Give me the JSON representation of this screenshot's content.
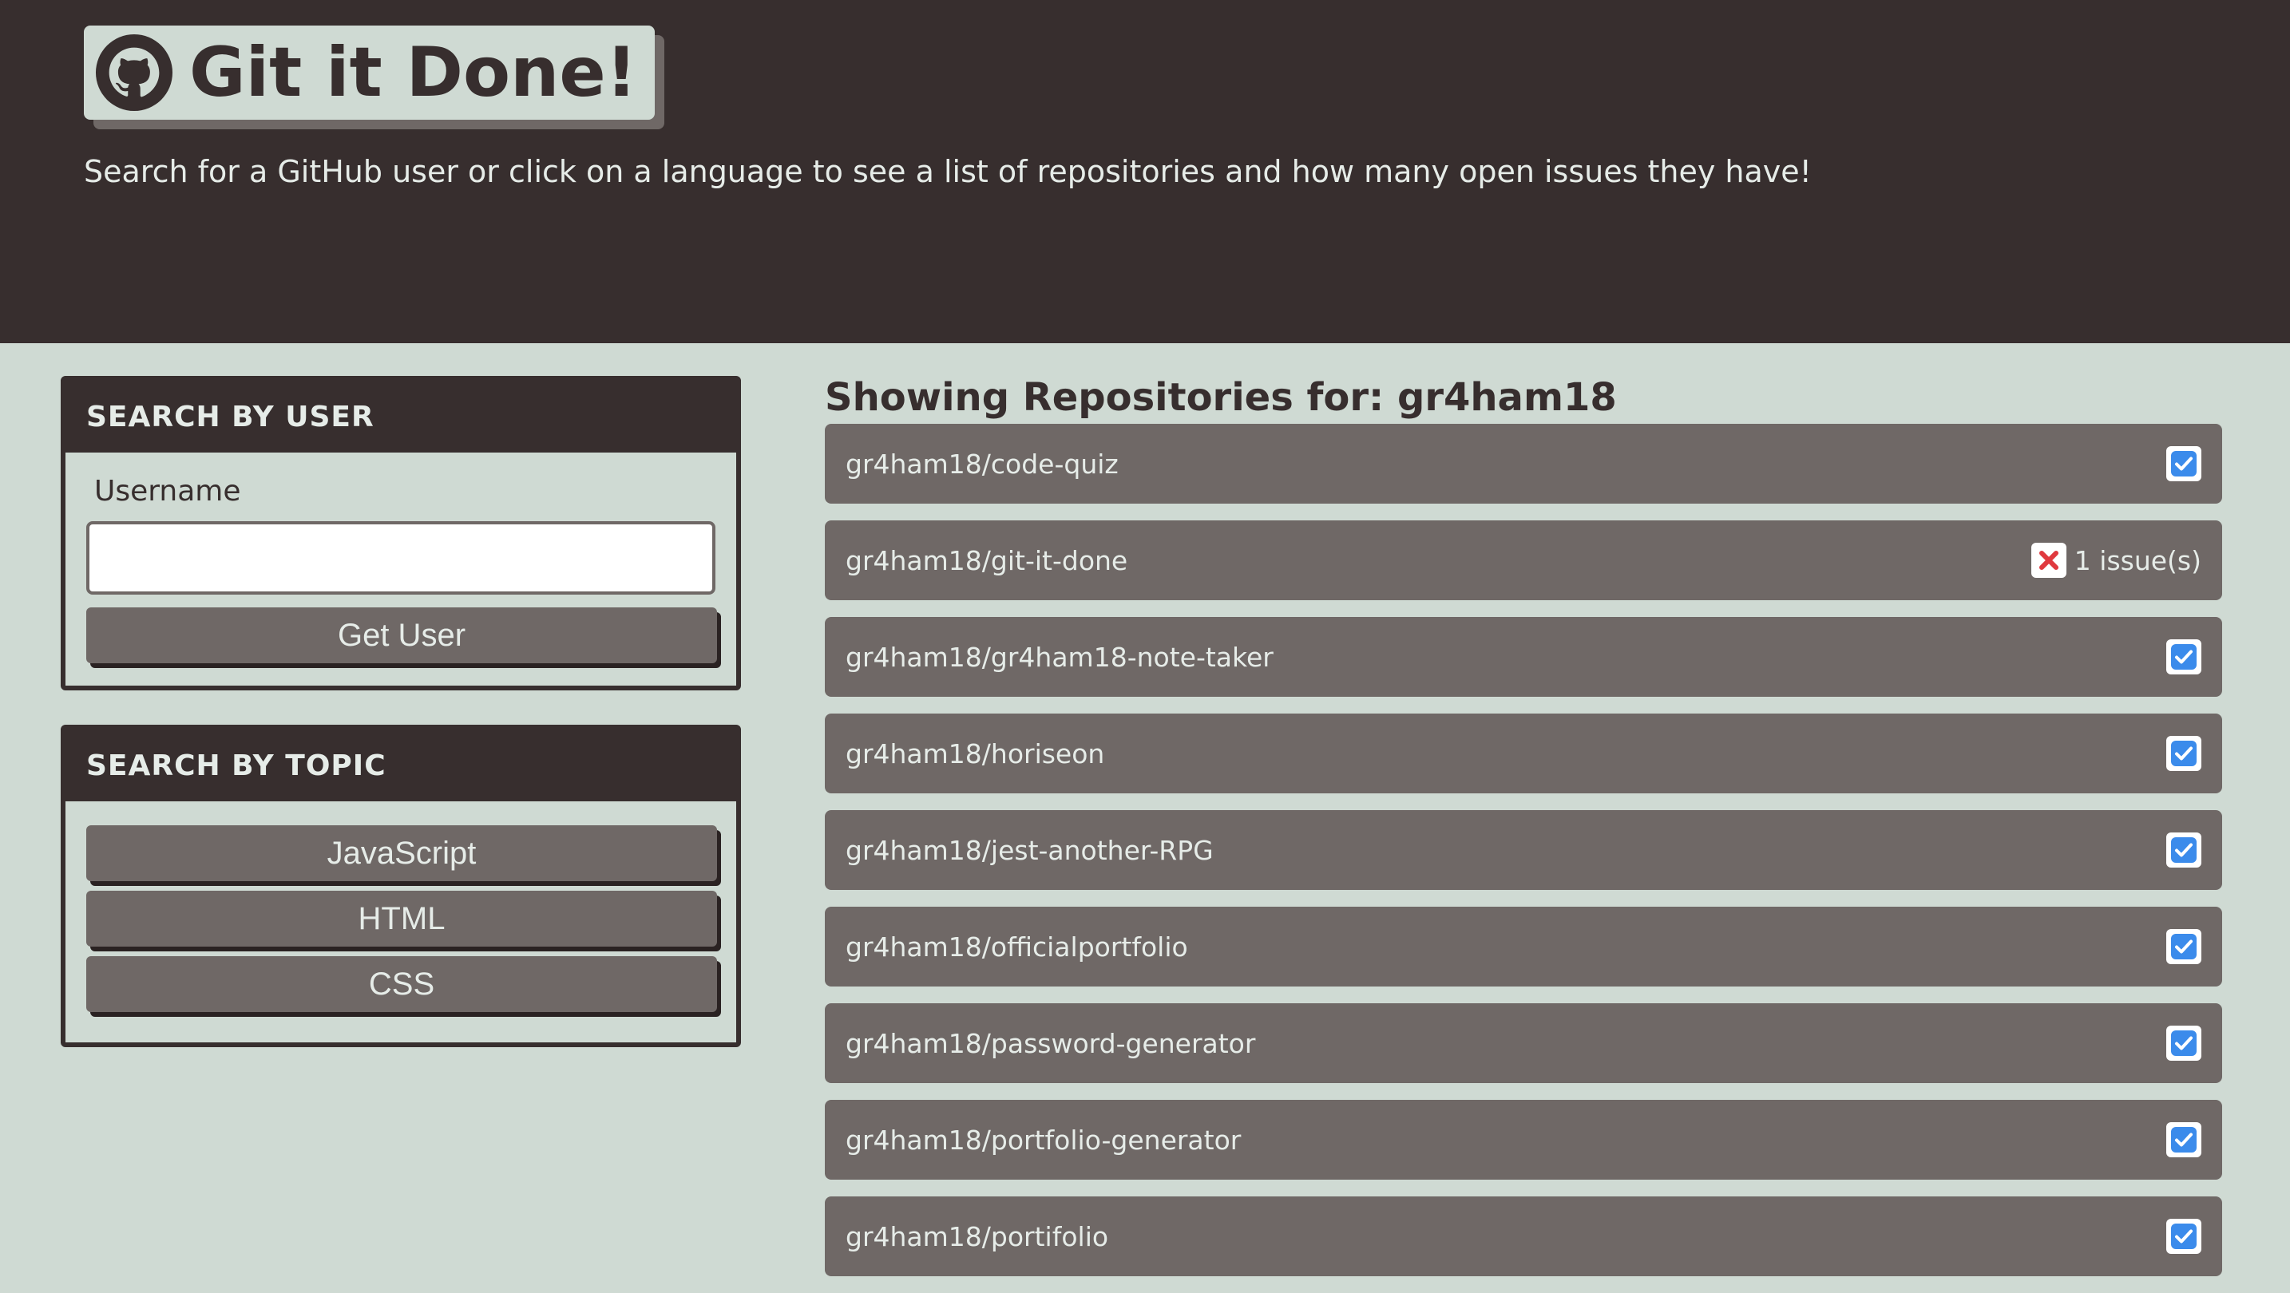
{
  "header": {
    "title": "Git it Done!",
    "subtitle": "Search for a GitHub user or click on a language to see a list of repositories and how many open issues they have!",
    "logo_icon": "github-icon"
  },
  "user_search": {
    "heading": "SEARCH BY USER",
    "label": "Username",
    "input_value": "",
    "button_label": "Get User"
  },
  "topic_search": {
    "heading": "SEARCH BY TOPIC",
    "buttons": [
      {
        "label": "JavaScript"
      },
      {
        "label": "HTML"
      },
      {
        "label": "CSS"
      }
    ]
  },
  "results": {
    "heading": "Showing Repositories for: gr4ham18",
    "repos": [
      {
        "name": "gr4ham18/code-quiz",
        "status_icon": "check-square-icon",
        "issues_text": ""
      },
      {
        "name": "gr4ham18/git-it-done",
        "status_icon": "x-square-icon",
        "issues_text": "1 issue(s)"
      },
      {
        "name": "gr4ham18/gr4ham18-note-taker",
        "status_icon": "check-square-icon",
        "issues_text": ""
      },
      {
        "name": "gr4ham18/horiseon",
        "status_icon": "check-square-icon",
        "issues_text": ""
      },
      {
        "name": "gr4ham18/jest-another-RPG",
        "status_icon": "check-square-icon",
        "issues_text": ""
      },
      {
        "name": "gr4ham18/officialportfolio",
        "status_icon": "check-square-icon",
        "issues_text": ""
      },
      {
        "name": "gr4ham18/password-generator",
        "status_icon": "check-square-icon",
        "issues_text": ""
      },
      {
        "name": "gr4ham18/portfolio-generator",
        "status_icon": "check-square-icon",
        "issues_text": ""
      },
      {
        "name": "gr4ham18/portifolio",
        "status_icon": "check-square-icon",
        "issues_text": ""
      }
    ]
  },
  "colors": {
    "header_bg": "#372e2e",
    "page_bg": "#cfdad3",
    "item_bg": "#6f6866",
    "check": "#3b8beb",
    "cross": "#e0393e"
  }
}
